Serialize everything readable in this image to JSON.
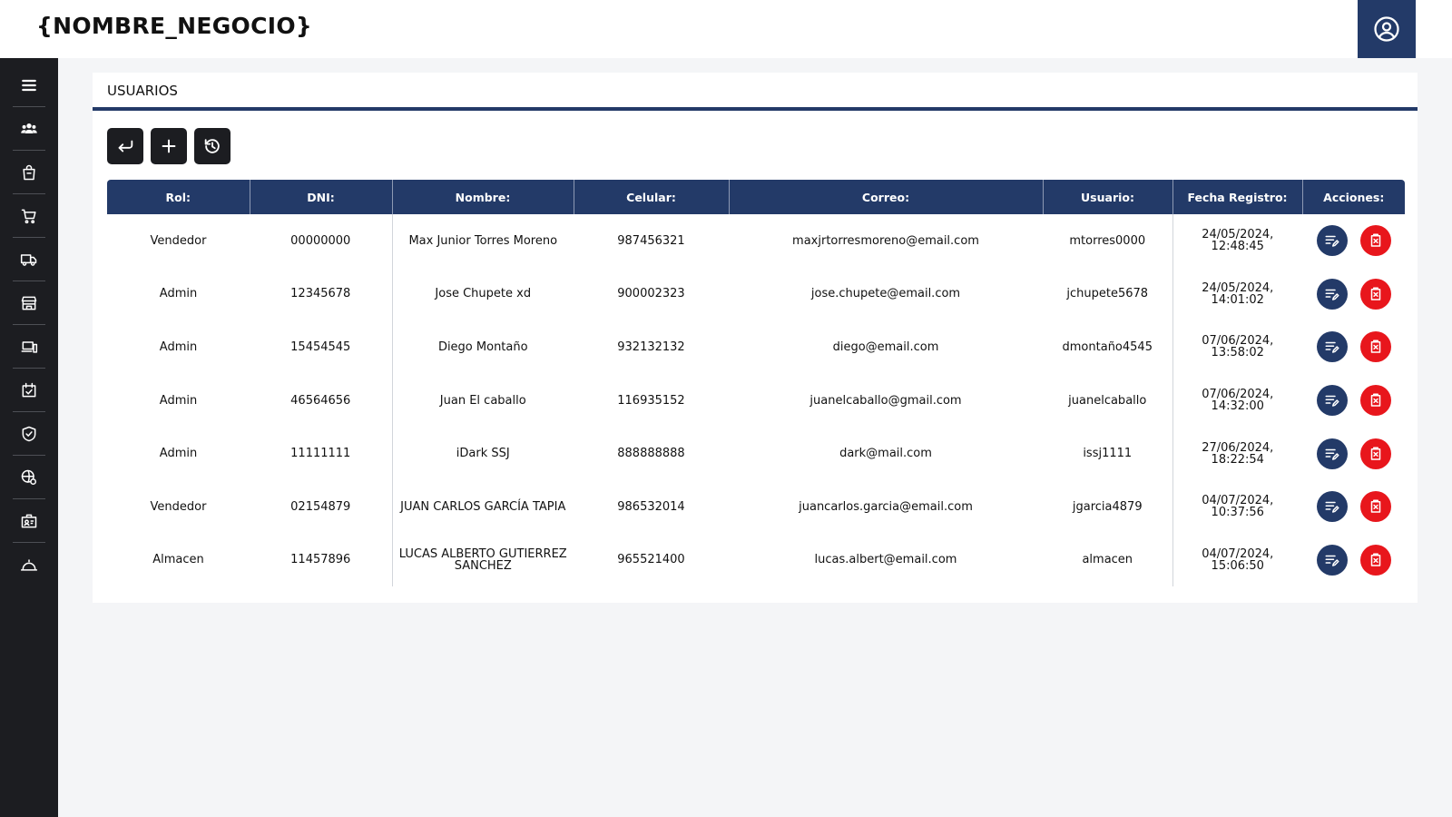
{
  "app": {
    "brand": "{NOMBRE_NEGOCIO}"
  },
  "header": {
    "user_icon": "user-circle-icon"
  },
  "sidebar": {
    "items": [
      {
        "icon": "menu-icon"
      },
      {
        "icon": "users-icon"
      },
      {
        "icon": "shopping-bag-icon"
      },
      {
        "icon": "cart-icon"
      },
      {
        "icon": "truck-icon"
      },
      {
        "icon": "store-icon"
      },
      {
        "icon": "devices-icon"
      },
      {
        "icon": "calendar-check-icon"
      },
      {
        "icon": "shield-check-icon"
      },
      {
        "icon": "world-settings-icon"
      },
      {
        "icon": "id-card-icon"
      },
      {
        "icon": "logout-icon"
      }
    ]
  },
  "page": {
    "title": "USUARIOS"
  },
  "toolbar": {
    "buttons": [
      "back-arrow-icon",
      "plus-icon",
      "history-icon"
    ]
  },
  "table": {
    "headers": {
      "rol": "Rol:",
      "dni": "DNI:",
      "nombre": "Nombre:",
      "celular": "Celular:",
      "correo": "Correo:",
      "usuario": "Usuario:",
      "fecha": "Fecha Registro:",
      "acciones": "Acciones:"
    },
    "rows": [
      {
        "rol": "Vendedor",
        "dni": "00000000",
        "nombre": "Max Junior Torres Moreno",
        "celular": "987456321",
        "correo": "maxjrtorresmoreno@email.com",
        "usuario": "mtorres0000",
        "fecha": "24/05/2024, 12:48:45"
      },
      {
        "rol": "Admin",
        "dni": "12345678",
        "nombre": "Jose Chupete xd",
        "celular": "900002323",
        "correo": "jose.chupete@email.com",
        "usuario": "jchupete5678",
        "fecha": "24/05/2024, 14:01:02"
      },
      {
        "rol": "Admin",
        "dni": "15454545",
        "nombre": "Diego Montaño",
        "celular": "932132132",
        "correo": "diego@email.com",
        "usuario": "dmontaño4545",
        "fecha": "07/06/2024, 13:58:02"
      },
      {
        "rol": "Admin",
        "dni": "46564656",
        "nombre": "Juan El caballo",
        "celular": "116935152",
        "correo": "juanelcaballo@gmail.com",
        "usuario": "juanelcaballo",
        "fecha": "07/06/2024, 14:32:00"
      },
      {
        "rol": "Admin",
        "dni": "11111111",
        "nombre": "iDark SSJ",
        "celular": "888888888",
        "correo": "dark@mail.com",
        "usuario": "issj1111",
        "fecha": "27/06/2024, 18:22:54"
      },
      {
        "rol": "Vendedor",
        "dni": "02154879",
        "nombre": "JUAN CARLOS GARCÍA TAPIA",
        "celular": "986532014",
        "correo": "juancarlos.garcia@email.com",
        "usuario": "jgarcia4879",
        "fecha": "04/07/2024, 10:37:56"
      },
      {
        "rol": "Almacen",
        "dni": "11457896",
        "nombre": "LUCAS ALBERTO GUTIERREZ SANCHEZ",
        "celular": "965521400",
        "correo": "lucas.albert@email.com",
        "usuario": "almacen",
        "fecha": "04/07/2024, 15:06:50"
      }
    ]
  },
  "colors": {
    "primary": "#233a68",
    "danger": "#e8161c",
    "sidebar": "#1c1d21",
    "background": "#f4f5f7"
  }
}
